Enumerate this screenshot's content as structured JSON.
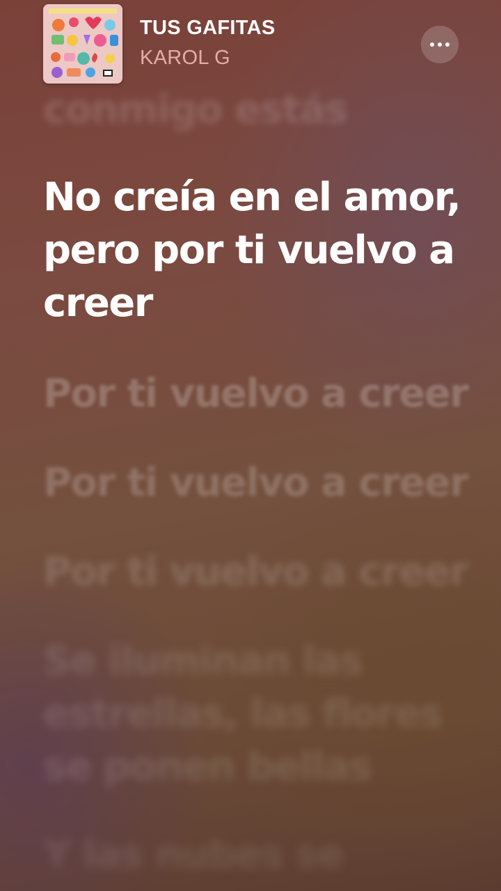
{
  "now_playing": {
    "title": "TUS GAFITAS",
    "artist": "KAROL G",
    "artwork_icon": "album-artwork",
    "more_icon": "ellipsis-icon"
  },
  "lyrics": {
    "previous": "conmigo estás",
    "current": "No creía en el amor, pero por ti vuelvo a creer",
    "upcoming": [
      "Por ti vuelvo a creer",
      "Por ti vuelvo a creer",
      "Por ti vuelvo a creer",
      "Se iluminan las estrellas, las flores se ponen bellas",
      "Y las nubes se"
    ]
  },
  "colors": {
    "accent_artist": "#ffc8c3",
    "active_line": "#ffffff"
  }
}
